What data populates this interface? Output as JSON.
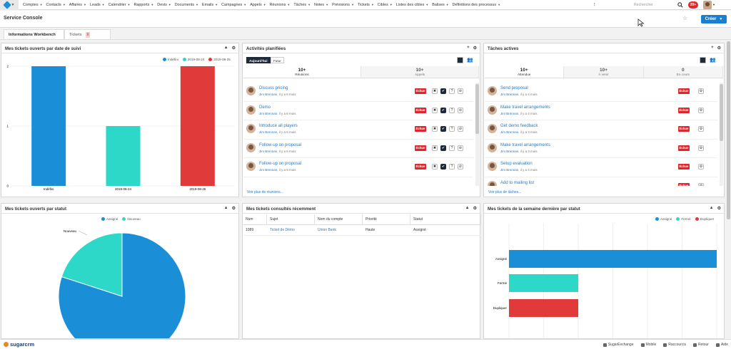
{
  "nav": {
    "items": [
      "Comptes",
      "Contacts",
      "Affaires",
      "Leads",
      "Calendrier",
      "Rapports",
      "Devis",
      "Documents",
      "Emails",
      "Campagnes",
      "Appels",
      "Réunions",
      "Tâches",
      "Notes",
      "Prévisions",
      "Tickets",
      "Cibles",
      "Listes des cibles",
      "Balises",
      "Définitions des processus"
    ],
    "more": "⋮",
    "search_placeholder": "Rechercher",
    "notification_count": "20+"
  },
  "header": {
    "title": "Service Console",
    "create_label": "Créer"
  },
  "tabs": {
    "info": "Informations Workbench",
    "tickets": "Tickets",
    "close": "X"
  },
  "dashlet_followup": {
    "title": "Mes tickets ouverts par date de suivi",
    "legend": [
      "Indéfini",
      "2019-08-24",
      "2019-08-25"
    ],
    "colors": {
      "blue": "#1b8ed8",
      "teal": "#2ed8c8",
      "red": "#e03a3a"
    }
  },
  "chart_data": [
    {
      "type": "bar",
      "title": "Mes tickets ouverts par date de suivi",
      "categories": [
        "Indéfini",
        "2019-08-24",
        "2019-08-25"
      ],
      "values": [
        2,
        1,
        2
      ],
      "yticks": [
        "0",
        "1",
        "2"
      ],
      "ylim": [
        0,
        2
      ]
    },
    {
      "type": "pie",
      "title": "Mes tickets ouverts par statut",
      "categories": [
        "Assigné",
        "Nouveau"
      ],
      "values": [
        80,
        20
      ]
    },
    {
      "type": "bar",
      "orientation": "horizontal",
      "title": "Mes tickets de la semaine dernière par statut",
      "categories": [
        "Assigné",
        "Fermé",
        "Dupliquer"
      ],
      "values": [
        3,
        1,
        1
      ],
      "xlim": [
        0,
        3
      ]
    }
  ],
  "activities": {
    "title": "Activités planifiées",
    "toggle_today": "Aujourd'hui",
    "toggle_future": "Futur",
    "tabs": [
      {
        "count": "10+",
        "label": "Réunions"
      },
      {
        "count": "10+",
        "label": "Appels"
      }
    ],
    "rows": [
      {
        "title": "Discuss pricing",
        "user": "Jim Brennan",
        "when": ", il y a 6 mois"
      },
      {
        "title": "Demo",
        "user": "Jim Brennan",
        "when": ", il y a 6 mois"
      },
      {
        "title": "Introduce all players",
        "user": "Jim Brennan",
        "when": ", il y a 5 mois"
      },
      {
        "title": "Follow-up on proposal",
        "user": "Jim Brennan",
        "when": ", il y a 5 mois"
      },
      {
        "title": "Follow-up on proposal",
        "user": "Jim Brennan",
        "when": ", il y a 5 mois"
      }
    ],
    "overdue_label": "Échue",
    "more": "Voir plus de réunions..."
  },
  "tasks": {
    "title": "Tâches actives",
    "tabs": [
      {
        "count": "10+",
        "label": "Attendue"
      },
      {
        "count": "10+",
        "label": "À venir"
      },
      {
        "count": "0",
        "label": "En cours"
      }
    ],
    "rows": [
      {
        "title": "Send proposal",
        "user": "Jim Brennan",
        "when": ", il y a 4 mois"
      },
      {
        "title": "Make travel arrangements",
        "user": "Jim Brennan",
        "when": ", il y a 4 mois"
      },
      {
        "title": "Get demo feedback",
        "user": "Jim Brennan",
        "when": ", il y a 3 mois"
      },
      {
        "title": "Make travel arrangements",
        "user": "Jim Brennan",
        "when": ", il y a 3 mois"
      },
      {
        "title": "Setup evaluation",
        "user": "Jim Brennan",
        "when": ", il y a 4 mois"
      },
      {
        "title": "Add to mailing list",
        "user": "",
        "when": ""
      }
    ],
    "overdue_label": "Échue",
    "more": "Voir plus de tâches..."
  },
  "status_pie": {
    "title": "Mes tickets ouverts par statut",
    "legend": [
      "Assigné",
      "Nouveau"
    ],
    "callout": "Nouveau"
  },
  "recent": {
    "title": "Mes tickets consultés récemment",
    "headers": [
      "Num",
      "Sujet",
      "Nom du compte",
      "Priorité",
      "Statut"
    ],
    "rows": [
      [
        "1089",
        "Ticket de Démo",
        "Union Bank",
        "Haute",
        "Assigné"
      ]
    ]
  },
  "weekly": {
    "title": "Mes tickets de la semaine dernière par statut",
    "legend": [
      "Assigné",
      "Fermé",
      "Dupliquer"
    ]
  },
  "footer": {
    "brand": "sugarcrm",
    "links": [
      "SugarExchange",
      "Mobile",
      "Raccourcis",
      "Retour",
      "Aide"
    ]
  }
}
